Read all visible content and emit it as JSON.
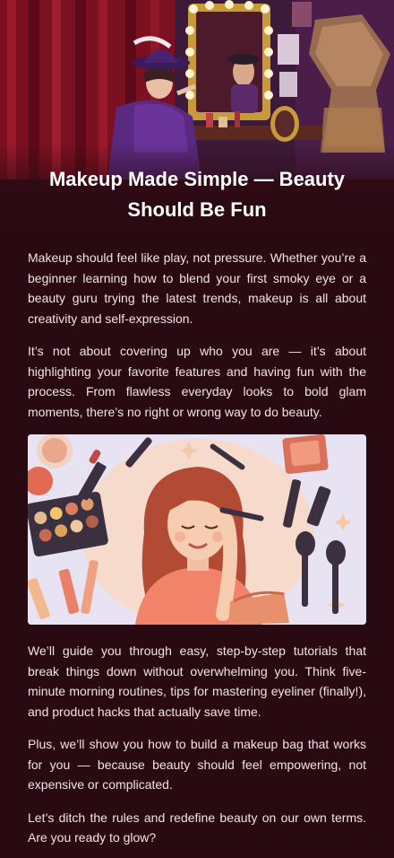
{
  "article": {
    "title": "Makeup Made Simple — Beauty Should Be Fun",
    "paragraphs_top": [
      "Makeup should feel like play, not pressure. Whether you’re a beginner learning how to blend your first smoky eye or a beauty guru trying the latest trends, makeup is all about creativity and self-expression.",
      "It’s not about covering up who you are — it’s about highlighting your favorite features and having fun with the process. From flawless everyday looks to bold glam moments, there’s no right or wrong way to do beauty."
    ],
    "paragraphs_bottom": [
      "We’ll guide you through easy, step-by-step tutorials that break things down without overwhelming you. Think five-minute morning routines, tips for mastering eyeliner (finally!), and product hacks that actually save time.",
      "Plus, we’ll show you how to build a makeup bag that works for you — because beauty should feel empowering, not expensive or complicated.",
      "Let’s ditch the rules and redefine beauty on our own terms. Are you ready to glow?"
    ]
  },
  "colors": {
    "background": "#2a0a12",
    "text": "#efe4e8",
    "title": "#ffffff",
    "illustration_bg": "#e7e3f3",
    "curtain": "#7a1020",
    "sweater": "#f2836b"
  },
  "images": {
    "hero": "vintage-vanity-mirror-photo",
    "illustration": "woman-applying-makeup-illustration"
  }
}
